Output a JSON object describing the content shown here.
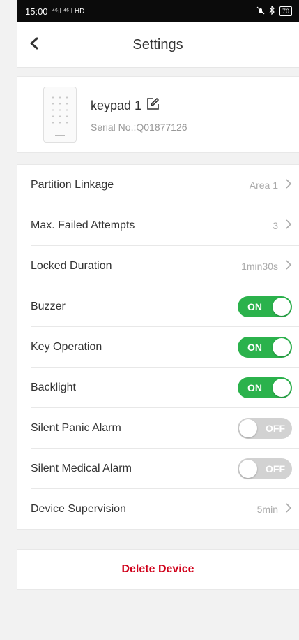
{
  "status_bar": {
    "time": "15:00",
    "network": "⁴⁶ıl ⁴⁶ıl HD",
    "battery": "70"
  },
  "header": {
    "title": "Settings",
    "back_icon": "chevron-left-icon"
  },
  "device": {
    "name": "keypad 1",
    "serial": "Serial No.:Q01877126",
    "edit_icon": "edit-icon"
  },
  "settings": [
    {
      "label": "Partition Linkage",
      "value": "Area 1",
      "type": "link"
    },
    {
      "label": "Max. Failed Attempts",
      "value": "3",
      "type": "link"
    },
    {
      "label": "Locked Duration",
      "value": "1min30s",
      "type": "link"
    },
    {
      "label": "Buzzer",
      "value": "ON",
      "type": "toggle",
      "on": true
    },
    {
      "label": "Key Operation",
      "value": "ON",
      "type": "toggle",
      "on": true
    },
    {
      "label": "Backlight",
      "value": "ON",
      "type": "toggle",
      "on": true
    },
    {
      "label": "Silent Panic Alarm",
      "value": "OFF",
      "type": "toggle",
      "on": false
    },
    {
      "label": "Silent Medical Alarm",
      "value": "OFF",
      "type": "toggle",
      "on": false
    },
    {
      "label": "Device Supervision",
      "value": "5min",
      "type": "link"
    }
  ],
  "delete_label": "Delete Device",
  "colors": {
    "toggle_on": "#2bb24c",
    "toggle_off": "#d2d2d2",
    "danger": "#d0021b"
  }
}
